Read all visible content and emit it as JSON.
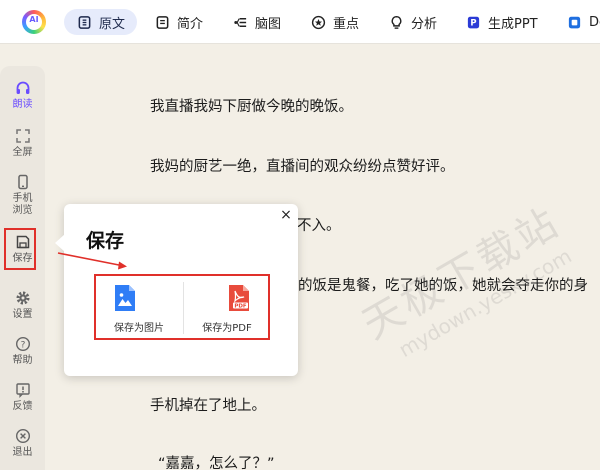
{
  "toolbar": {
    "logo_text": "AI",
    "tabs": [
      {
        "label": "原文",
        "icon": "document-icon"
      },
      {
        "label": "简介",
        "icon": "summary-icon"
      },
      {
        "label": "脑图",
        "icon": "mindmap-icon"
      },
      {
        "label": "重点",
        "icon": "star-icon"
      },
      {
        "label": "分析",
        "icon": "lightbulb-icon"
      },
      {
        "label": "生成PPT",
        "icon": "ppt-icon"
      },
      {
        "label": "Do",
        "icon": "doc-icon"
      }
    ]
  },
  "sidebar": {
    "items": [
      {
        "label": "朗读",
        "icon": "headphones-icon"
      },
      {
        "label": "全屏",
        "icon": "fullscreen-icon"
      },
      {
        "label": "手机\n浏览",
        "label_line1": "手机",
        "label_line2": "浏览",
        "icon": "phone-icon"
      },
      {
        "label": "保存",
        "icon": "save-icon"
      },
      {
        "label": "设置",
        "icon": "gear-icon"
      },
      {
        "label": "帮助",
        "icon": "help-icon"
      },
      {
        "label": "反馈",
        "icon": "feedback-icon"
      },
      {
        "label": "退出",
        "icon": "exit-icon"
      }
    ]
  },
  "content": {
    "paragraphs": [
      "我直播我妈下厨做今晚的晚饭。",
      "我妈的厨艺一绝，直播间的观众纷纷点赞好评。",
      "不入。",
      "的饭是鬼餐，吃了她的饭，她就会夺走你的身",
      "手机掉在了地上。",
      "“嘉嘉，怎么了？”"
    ]
  },
  "save_popup": {
    "title": "保存",
    "close": "×",
    "options": [
      {
        "label": "保存为图片",
        "icon": "image-file-icon"
      },
      {
        "label": "保存为PDF",
        "icon": "pdf-file-icon"
      }
    ]
  },
  "watermark": {
    "line1": "天极下载站",
    "line2": "mydown.yesky.com"
  },
  "colors": {
    "accent": "#6a4cff",
    "highlight_red": "#e0302a",
    "page_bg": "#f3efe6",
    "image_icon_blue": "#2f7df6",
    "pdf_icon_red": "#e84b3c"
  }
}
